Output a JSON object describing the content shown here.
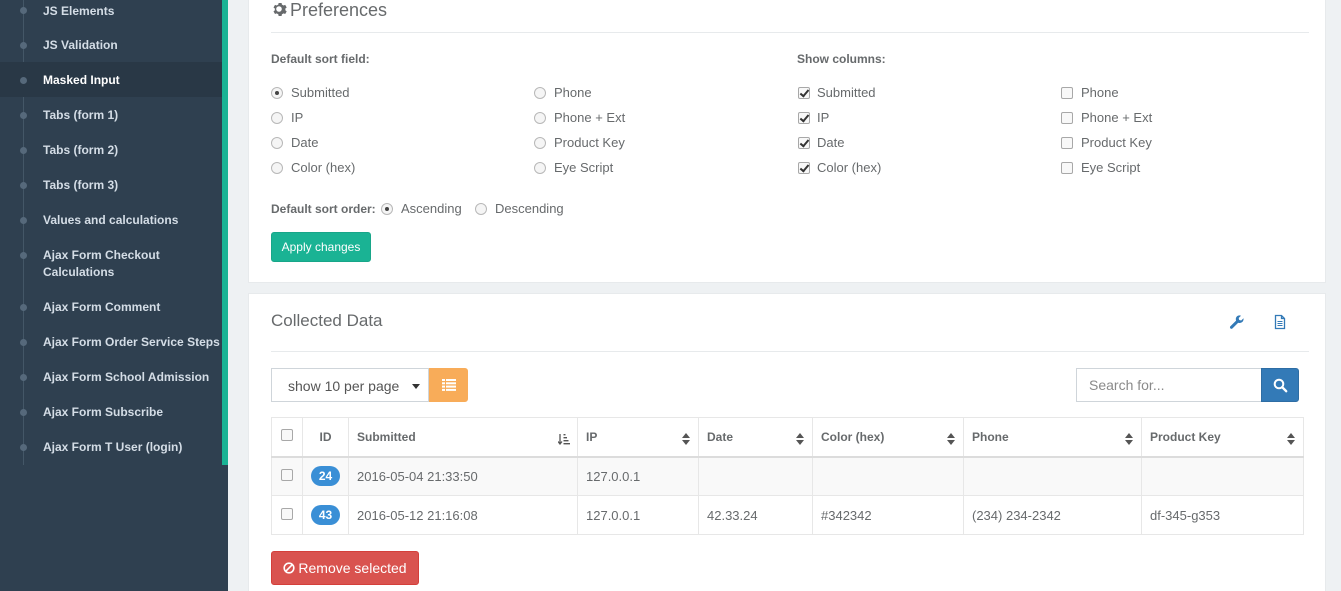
{
  "sidebar": {
    "items": [
      {
        "label": "JS Elements",
        "active": false
      },
      {
        "label": "JS Validation",
        "active": false
      },
      {
        "label": "Masked Input",
        "active": true
      },
      {
        "label": "Tabs (form 1)",
        "active": false
      },
      {
        "label": "Tabs (form 2)",
        "active": false
      },
      {
        "label": "Tabs (form 3)",
        "active": false
      },
      {
        "label": "Values and calculations",
        "active": false
      },
      {
        "label": "Ajax Form Checkout Calculations",
        "active": false
      },
      {
        "label": "Ajax Form Comment",
        "active": false
      },
      {
        "label": "Ajax Form Order Service Steps",
        "active": false
      },
      {
        "label": "Ajax Form School Admission",
        "active": false
      },
      {
        "label": "Ajax Form Subscribe",
        "active": false
      },
      {
        "label": "Ajax Form T User (login)",
        "active": false
      }
    ]
  },
  "preferences": {
    "title": "Preferences",
    "sort_field_label": "Default sort field:",
    "sort_field_options": [
      {
        "label": "Submitted",
        "checked": true
      },
      {
        "label": "IP",
        "checked": false
      },
      {
        "label": "Date",
        "checked": false
      },
      {
        "label": "Color (hex)",
        "checked": false
      },
      {
        "label": "Phone",
        "checked": false
      },
      {
        "label": "Phone + Ext",
        "checked": false
      },
      {
        "label": "Product Key",
        "checked": false
      },
      {
        "label": "Eye Script",
        "checked": false
      }
    ],
    "show_columns_label": "Show columns:",
    "show_columns_options": [
      {
        "label": "Submitted",
        "checked": true
      },
      {
        "label": "IP",
        "checked": true
      },
      {
        "label": "Date",
        "checked": true
      },
      {
        "label": "Color (hex)",
        "checked": true
      },
      {
        "label": "Phone",
        "checked": false
      },
      {
        "label": "Phone + Ext",
        "checked": false
      },
      {
        "label": "Product Key",
        "checked": false
      },
      {
        "label": "Eye Script",
        "checked": false
      }
    ],
    "sort_order_label": "Default sort order:",
    "sort_order_options": [
      {
        "label": "Ascending",
        "checked": true
      },
      {
        "label": "Descending",
        "checked": false
      }
    ],
    "apply_label": "Apply changes"
  },
  "collected": {
    "title": "Collected Data",
    "per_page": "show 10 per page",
    "search_placeholder": "Search for...",
    "columns": [
      "ID",
      "Submitted",
      "IP",
      "Date",
      "Color (hex)",
      "Phone",
      "Product Key"
    ],
    "rows": [
      {
        "id": "24",
        "submitted": "2016-05-04 21:33:50",
        "ip": "127.0.0.1",
        "date": "",
        "color": "",
        "phone": "",
        "product_key": ""
      },
      {
        "id": "43",
        "submitted": "2016-05-12 21:16:08",
        "ip": "127.0.0.1",
        "date": "42.33.24",
        "color": "#342342",
        "phone": "(234) 234-2342",
        "product_key": "df-345-g353"
      }
    ],
    "remove_label": "Remove selected"
  },
  "colors": {
    "sidebar_bg": "#2f4050",
    "accent_green": "#1ab394",
    "badge_blue": "#3a8fd6",
    "warning_orange": "#f8ac59",
    "danger_red": "#d9534f",
    "primary_blue": "#337ab7"
  },
  "icons": [
    "gear-icon",
    "wrench-icon",
    "document-icon",
    "list-icon",
    "search-icon",
    "sort-amount-icon",
    "sort-icon",
    "ban-icon"
  ]
}
